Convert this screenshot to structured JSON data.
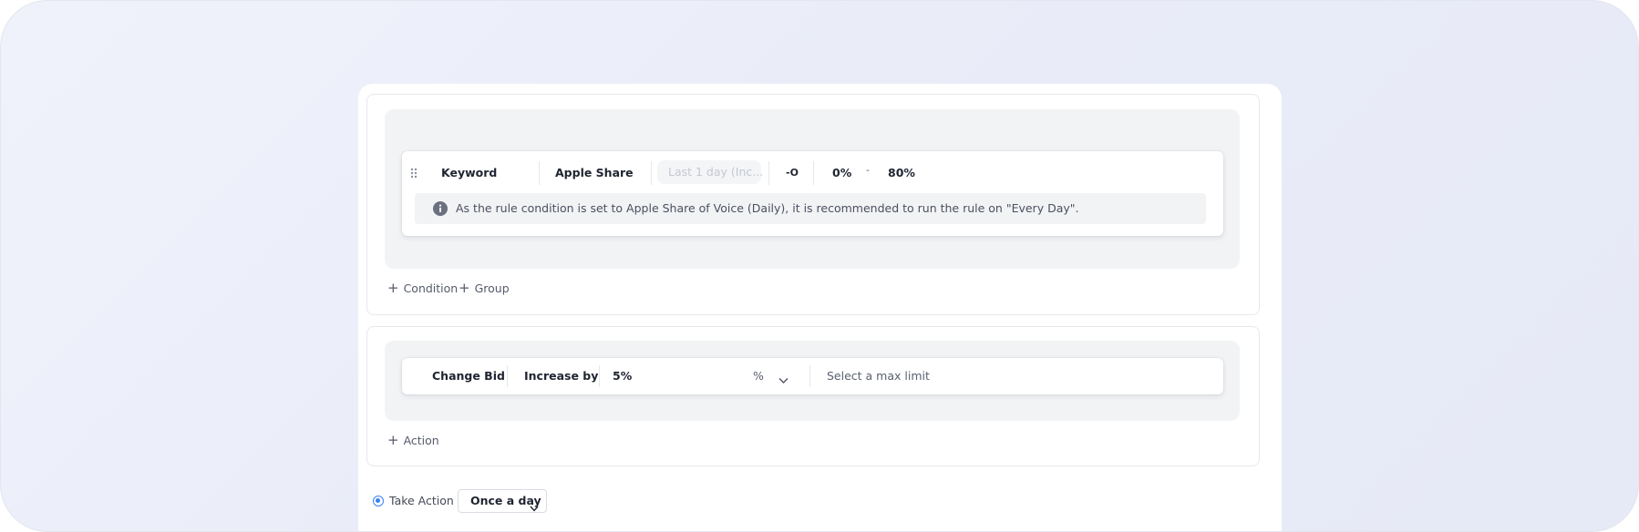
{
  "condition_block": {
    "row": {
      "field": "Keyword",
      "metric": "Apple Share of V",
      "period_placeholder": "Last 1 day (Inc...",
      "operator_symbol": "-O",
      "min_value": "0%",
      "range_dash": "-",
      "max_value": "80%"
    },
    "info_message": "As the rule condition is set to Apple Share of Voice (Daily), it is recommended to run the rule on \"Every Day\".",
    "add_condition_label": "Condition",
    "add_group_label": "Group"
  },
  "action_block": {
    "row": {
      "action_type": "Change Bid",
      "direction": "Increase by",
      "amount": "5%",
      "unit": "%",
      "max_limit_placeholder": "Select a max limit"
    },
    "add_action_label": "Action"
  },
  "footer": {
    "take_action_label": "Take Action",
    "frequency": "Once a day"
  },
  "colors": {
    "accent": "#3b82f6",
    "panel_gray": "#f2f3f5",
    "info_icon": "#6b7080"
  }
}
